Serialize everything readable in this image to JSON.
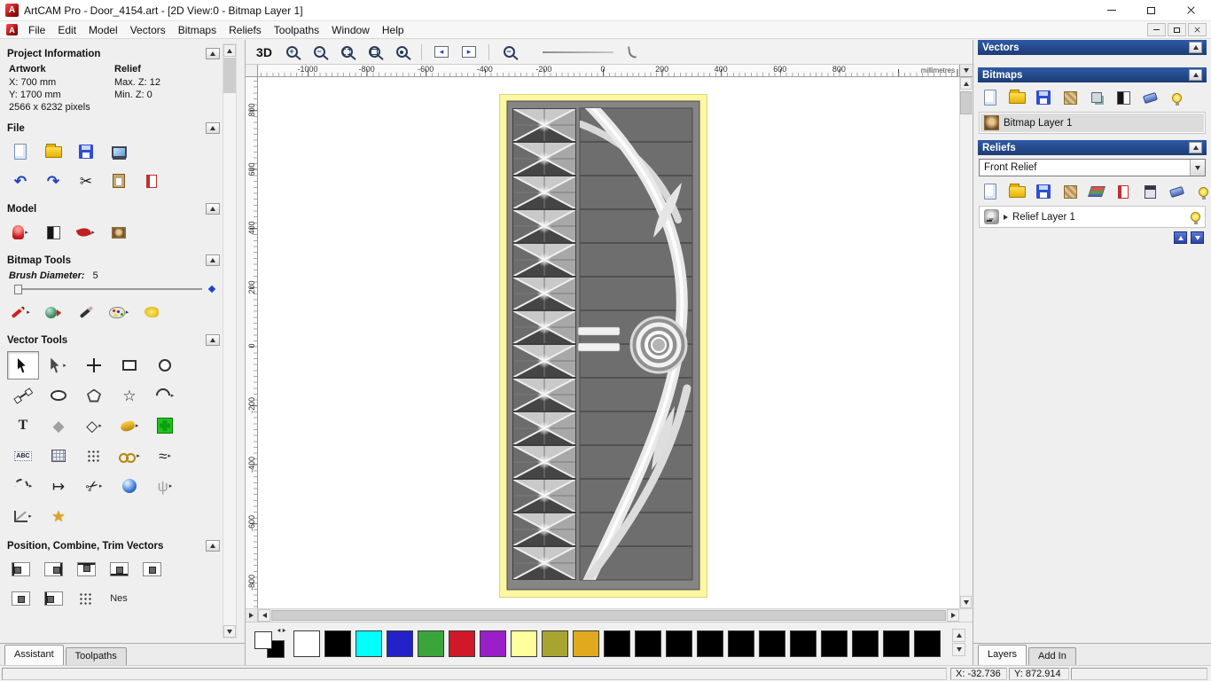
{
  "titlebar": {
    "logo_glyph": "A",
    "title": "ArtCAM Pro - Door_4154.art - [2D View:0 - Bitmap Layer 1]"
  },
  "menubar": {
    "items": [
      "File",
      "Edit",
      "Model",
      "Vectors",
      "Bitmaps",
      "Reliefs",
      "Toolpaths",
      "Window",
      "Help"
    ]
  },
  "colors": {
    "header_blue": "#24477f",
    "door_border_yellow": "#fcf7a0",
    "panel_gray": "#efefef"
  },
  "left_panel": {
    "project_info": {
      "title": "Project Information",
      "col1_header": "Artwork",
      "col2_header": "Relief",
      "col1_lines": [
        "X: 700 mm",
        "Y: 1700 mm",
        "2566 x 6232 pixels"
      ],
      "col2_lines": [
        "Max. Z: 12",
        "Min. Z: 0"
      ]
    },
    "file_section_title": "File",
    "file_row1": [
      {
        "name": "new-model-button",
        "cls": "i-page"
      },
      {
        "name": "open-model-button",
        "cls": "i-folder"
      },
      {
        "name": "save-model-button",
        "cls": "i-disk"
      },
      {
        "name": "export-model-button",
        "cls": "i-monitor"
      }
    ],
    "file_row2": [
      {
        "name": "undo-button",
        "glyph": "↶",
        "cls": "g-blue"
      },
      {
        "name": "redo-button",
        "glyph": "↷",
        "cls": "g-blue"
      },
      {
        "name": "cut-button",
        "glyph": "✂",
        "cls": "g-dark big-g"
      },
      {
        "name": "paste-button",
        "cls": "i-clipboard"
      },
      {
        "name": "notes-button",
        "cls": "i-note"
      }
    ],
    "model_section_title": "Model",
    "model_row": [
      {
        "name": "model-lighting-button",
        "cls": "i-fig-red",
        "dd": true
      },
      {
        "name": "greyscale-preview-button",
        "cls": "i-contrast"
      },
      {
        "name": "sculpt-model-button",
        "cls": "i-sculpt-red",
        "dd": true
      },
      {
        "name": "image-to-model-button",
        "cls": "i-photo"
      }
    ],
    "bitmap_tools": {
      "title": "Bitmap Tools",
      "brush_label": "Brush Diameter:",
      "brush_value": "5"
    },
    "bitmap_row": [
      {
        "name": "paint-tool-button",
        "cls": "i-pencil-red",
        "dd": true
      },
      {
        "name": "flood-fill-button",
        "cls": "i-flood",
        "dd": true
      },
      {
        "name": "draw-tool-button",
        "cls": "i-pen-black"
      },
      {
        "name": "colour-palette-button",
        "cls": "i-palette",
        "dd": true
      },
      {
        "name": "magic-wand-button",
        "cls": "i-blob-yellow"
      }
    ],
    "vector_tools_title": "Vector Tools",
    "vector_rows": [
      [
        {
          "name": "select-vectors-tool",
          "cls": "i-cursor",
          "pressed": true
        },
        {
          "name": "node-editing-tool",
          "cls": "i-cursor lite",
          "dd": true
        },
        {
          "name": "transform-vectors-tool",
          "cls": "i-move"
        },
        {
          "name": "create-rectangle-tool",
          "cls": "i-rect"
        },
        {
          "name": "create-circle-tool",
          "cls": "i-circ"
        }
      ],
      [
        {
          "name": "create-polyline-tool",
          "cls": "i-poly"
        },
        {
          "name": "create-ellipse-tool",
          "cls": "i-oval"
        },
        {
          "name": "create-polygon-tool",
          "cls": "i-pentagon"
        },
        {
          "name": "create-star-tool",
          "glyph": "☆",
          "cls": "g-dark big-g"
        },
        {
          "name": "create-arc-tool",
          "cls": "i-arc",
          "dd": true
        }
      ],
      [
        {
          "name": "create-text-tool",
          "glyph": "T",
          "cls": "g-serif"
        },
        {
          "name": "distort-vector-tool",
          "glyph": "◆",
          "cls": "g-gray big-g"
        },
        {
          "name": "offset-vector-tool",
          "glyph": "◇",
          "cls": "g-dark big-g",
          "dd": true
        },
        {
          "name": "vector-clipart-tool",
          "cls": "i-gold-blob",
          "dd": true
        },
        {
          "name": "block-paste-tool",
          "cls": "i-green-cross"
        }
      ],
      [
        {
          "name": "text-on-curve-tool",
          "glyph": "ABC",
          "cls": "g-abc"
        },
        {
          "name": "fit-vectors-to-grid-tool",
          "cls": "i-grid"
        },
        {
          "name": "block-copy-tool",
          "cls": "i-dots"
        },
        {
          "name": "chain-vectors-tool",
          "cls": "i-chain",
          "dd": true
        },
        {
          "name": "fit-curve-tool",
          "glyph": "≈",
          "cls": "g-dark big-g",
          "dd": true
        }
      ],
      [
        {
          "name": "fit-arcs-tool",
          "cls": "i-arc dash",
          "dd": true
        },
        {
          "name": "join-vectors-tool",
          "glyph": "↦",
          "cls": "g-dark big-g"
        },
        {
          "name": "trim-vectors-tool",
          "glyph": "✂",
          "cls": "g-dark big-g snip",
          "dd": true
        },
        {
          "name": "interactive-distortion-tool",
          "cls": "i-dome"
        },
        {
          "name": "vector-doctor-tool",
          "glyph": "ψ",
          "cls": "g-gray big-g",
          "dd": true
        }
      ],
      [
        {
          "name": "measure-tool",
          "cls": "i-measure",
          "dd": true
        },
        {
          "name": "vector-wizard-tool",
          "glyph": "★",
          "cls": "g-gold big-g"
        }
      ]
    ],
    "position_title": "Position, Combine, Trim Vectors",
    "position_row": [
      {
        "name": "align-left-button",
        "cls": "al al-l"
      },
      {
        "name": "align-right-button",
        "cls": "al al-r"
      },
      {
        "name": "align-top-button",
        "cls": "al al-t"
      },
      {
        "name": "align-bottom-button",
        "cls": "al al-b"
      },
      {
        "name": "align-centre-button",
        "cls": "al al-c"
      }
    ],
    "position_row2": [
      {
        "name": "align-contour-button",
        "cls": "al al-c"
      },
      {
        "name": "paste-along-curve-button",
        "cls": "al al-l"
      },
      {
        "name": "block-nudge-button",
        "cls": "i-dots"
      },
      {
        "name": "nest-vectors-label",
        "glyph": "Nes",
        "cls": "g-text"
      }
    ],
    "tabs": [
      {
        "label": "Assistant",
        "active": true
      },
      {
        "label": "Toolpaths",
        "active": false
      }
    ]
  },
  "toolbar": {
    "items": [
      {
        "name": "toggle-3d-view-button",
        "glyph": "3D",
        "cls": "g-3d"
      },
      {
        "name": "zoom-in-button",
        "cls": "mag mag-plus"
      },
      {
        "name": "zoom-out-button",
        "cls": "mag mag-minus"
      },
      {
        "name": "zoom-window-button",
        "cls": "mag mag-rect"
      },
      {
        "name": "zoom-fit-button",
        "cls": "mag mag-fit"
      },
      {
        "name": "zoom-objects-button",
        "cls": "mag mag-dot"
      },
      {
        "sep": true
      },
      {
        "name": "pan-left-button",
        "glyph": "◂",
        "cls": "i-pan"
      },
      {
        "name": "pan-right-button",
        "glyph": "▸",
        "cls": "i-pan"
      },
      {
        "sep": true
      },
      {
        "name": "zoom-scale-button",
        "cls": "mag mag-minus"
      }
    ]
  },
  "rulers": {
    "horizontal": [
      "-1000",
      "-800",
      "-600",
      "-400",
      "-200",
      "0",
      "200",
      "400",
      "600",
      "800"
    ],
    "vertical": [
      "800",
      "600",
      "400",
      "200",
      "0",
      "-200",
      "-400",
      "-600",
      "-800"
    ],
    "unit": "millimetres"
  },
  "right_panel": {
    "vectors_title": "Vectors",
    "bitmaps_title": "Bitmaps",
    "bitmaps_toolbar": [
      {
        "name": "new-bitmap-layer-button",
        "cls": "i-page"
      },
      {
        "name": "open-bitmap-layer-button",
        "cls": "i-folder"
      },
      {
        "name": "save-bitmap-layer-button",
        "cls": "i-disk"
      },
      {
        "name": "bitmap-texture-button",
        "cls": "i-texture"
      },
      {
        "name": "copy-bitmap-layer-button",
        "cls": "i-small-sq"
      },
      {
        "name": "merge-bitmap-layers-button",
        "cls": "i-contrast"
      },
      {
        "name": "delete-bitmap-layer-button",
        "cls": "i-eraser-blue"
      },
      {
        "name": "toggle-bitmap-visibility-button",
        "cls": "i-bulb"
      }
    ],
    "bitmap_layer": "Bitmap Layer 1",
    "reliefs_title": "Reliefs",
    "relief_selected": "Front Relief",
    "reliefs_toolbar": [
      {
        "name": "new-relief-layer-button",
        "cls": "i-page"
      },
      {
        "name": "open-relief-layer-button",
        "cls": "i-folder"
      },
      {
        "name": "save-relief-layer-button",
        "cls": "i-disk"
      },
      {
        "name": "relief-texture-button",
        "cls": "i-texture"
      },
      {
        "name": "relief-stack-button",
        "cls": "i-stack"
      },
      {
        "name": "relief-note-button",
        "cls": "i-note"
      },
      {
        "name": "relief-calculate-button",
        "cls": "i-calc"
      },
      {
        "name": "delete-relief-layer-button",
        "cls": "i-eraser-blue"
      },
      {
        "name": "toggle-relief-visibility-button",
        "cls": "i-bulb"
      }
    ],
    "relief_layer": "Relief Layer 1",
    "tabs": [
      {
        "label": "Layers",
        "active": true
      },
      {
        "label": "Add In",
        "active": false
      }
    ]
  },
  "palette": {
    "colors": [
      "#ffffff",
      "#000000",
      "#00ffff",
      "#2222c8",
      "#3aa53a",
      "#d01828",
      "#9a1fc8",
      "#ffff9e",
      "#a8a432",
      "#e0a91e",
      "#000000",
      "#000000",
      "#000000",
      "#000000",
      "#000000",
      "#000000",
      "#000000",
      "#000000",
      "#000000",
      "#000000",
      "#000000"
    ]
  },
  "statusbar": {
    "x": "X: -32.736",
    "y": "Y: 872.914"
  }
}
